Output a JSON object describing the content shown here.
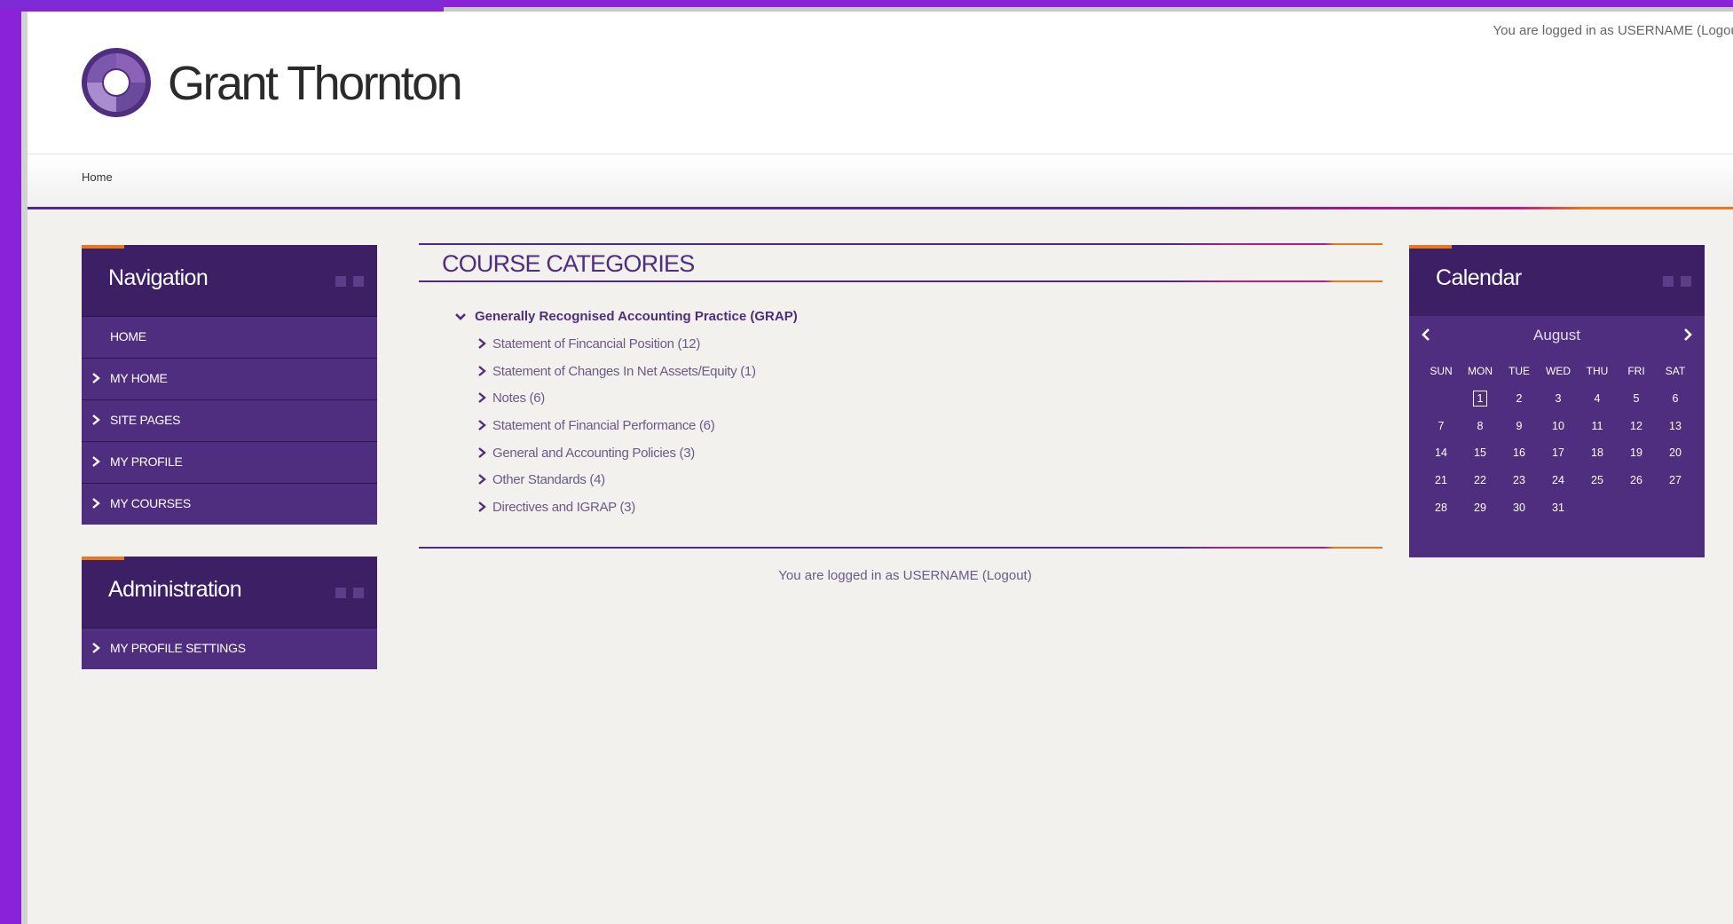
{
  "header": {
    "logo_text": "Grant Thornton",
    "login_text": "You are logged in as USERNAME (Logout)"
  },
  "breadcrumb": {
    "home": "Home"
  },
  "colors": {
    "purple_dark": "#3c1f65",
    "purple": "#4f2d7f",
    "magenta": "#b01f86",
    "orange": "#e8781e",
    "background": "#f2f1ee"
  },
  "navigation": {
    "title": "Navigation",
    "items": [
      {
        "label": "HOME",
        "icon": ""
      },
      {
        "label": "MY HOME",
        "icon": "chevron-right-icon"
      },
      {
        "label": "SITE PAGES",
        "icon": "chevron-right-icon"
      },
      {
        "label": "MY PROFILE",
        "icon": "chevron-right-icon"
      },
      {
        "label": "MY COURSES",
        "icon": "chevron-right-icon"
      }
    ]
  },
  "administration": {
    "title": "Administration",
    "items": [
      {
        "label": "MY PROFILE SETTINGS",
        "icon": "chevron-right-icon"
      }
    ]
  },
  "main": {
    "title": "COURSE CATEGORIES",
    "parent_category": "Generally Recognised Accounting Practice (GRAP)",
    "categories": [
      "Statement of Fincancial Position (12)",
      "Statement of Changes In Net Assets/Equity (1)",
      "Notes (6)",
      "Statement of Financial Performance (6)",
      "General and Accounting Policies (3)",
      "Other Standards (4)",
      "Directives and IGRAP (3)"
    ],
    "footer_login": "You are logged in as USERNAME (Logout)"
  },
  "calendar": {
    "title": "Calendar",
    "month": "August",
    "weekdays": [
      "SUN",
      "MON",
      "TUE",
      "WED",
      "THU",
      "FRI",
      "SAT"
    ],
    "weeks": [
      [
        "",
        "1",
        "2",
        "3",
        "4",
        "5",
        "6"
      ],
      [
        "7",
        "8",
        "9",
        "10",
        "11",
        "12",
        "13"
      ],
      [
        "14",
        "15",
        "16",
        "17",
        "18",
        "19",
        "20"
      ],
      [
        "21",
        "22",
        "23",
        "24",
        "25",
        "26",
        "27"
      ],
      [
        "28",
        "29",
        "30",
        "31",
        "",
        "",
        ""
      ]
    ],
    "today": "1"
  }
}
